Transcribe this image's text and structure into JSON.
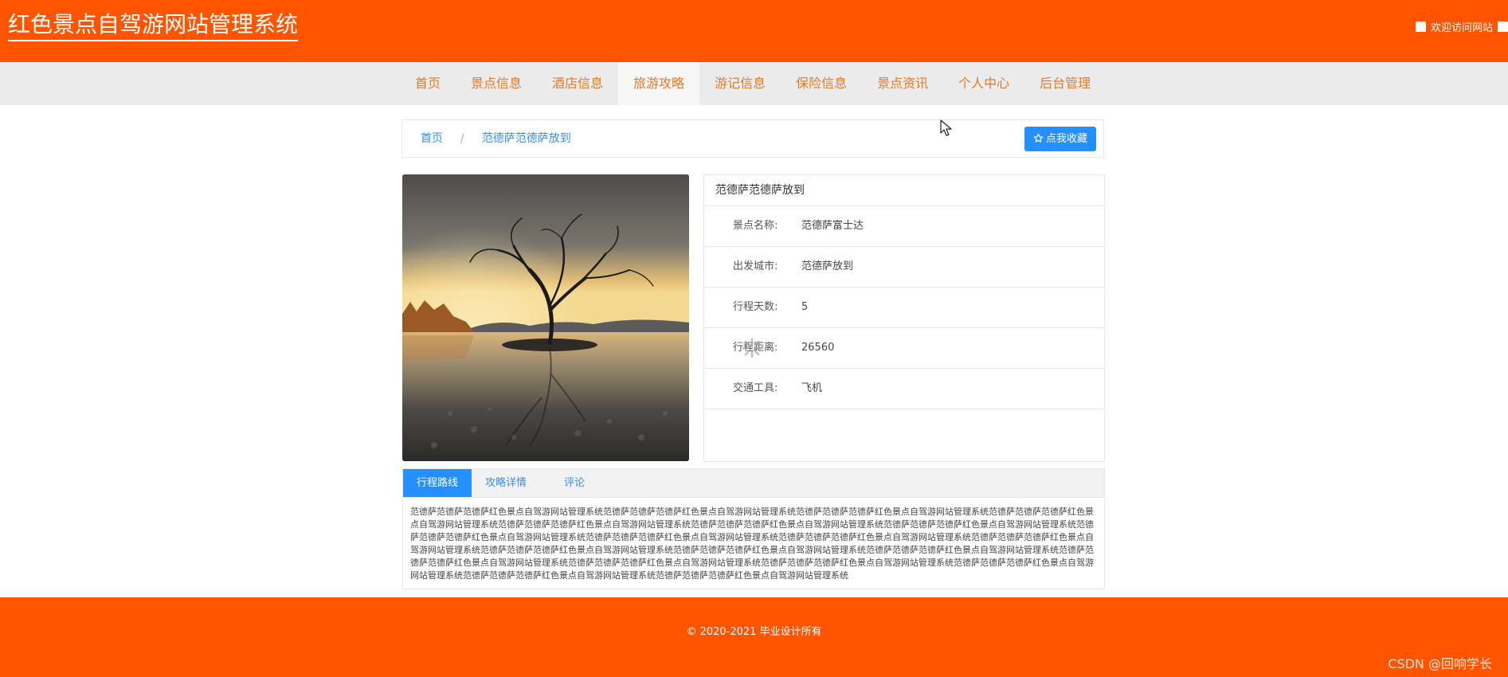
{
  "header": {
    "site_title": "红色景点自驾游网站管理系统",
    "welcome": "欢迎访问网站"
  },
  "nav": {
    "items": [
      {
        "label": "首页"
      },
      {
        "label": "景点信息"
      },
      {
        "label": "酒店信息"
      },
      {
        "label": "旅游攻略",
        "active": true
      },
      {
        "label": "游记信息"
      },
      {
        "label": "保险信息"
      },
      {
        "label": "景点资讯"
      },
      {
        "label": "个人中心"
      },
      {
        "label": "后台管理"
      }
    ]
  },
  "breadcrumb": {
    "home": "首页",
    "separator": "/",
    "current": "范德萨范德萨放到"
  },
  "actions": {
    "favorite_label": "点我收藏",
    "favorite_icon": "star-outline-icon"
  },
  "detail": {
    "title": "范德萨范德萨放到",
    "fields": [
      {
        "label": "景点名称:",
        "value": "范德萨富士达"
      },
      {
        "label": "出发城市:",
        "value": "范德萨放到"
      },
      {
        "label": "行程天数:",
        "value": "5"
      },
      {
        "label": "行程距离:",
        "value": "26560"
      },
      {
        "label": "交通工具:",
        "value": "飞机"
      }
    ]
  },
  "tabs": {
    "items": [
      {
        "label": "行程路线",
        "active": true
      },
      {
        "label": "攻略详情"
      },
      {
        "label": "评论"
      }
    ],
    "content": "范德萨范德萨范德萨红色景点自驾游网站管理系统范德萨范德萨范德萨红色景点自驾游网站管理系统范德萨范德萨范德萨红色景点自驾游网站管理系统范德萨范德萨范德萨红色景点自驾游网站管理系统范德萨范德萨范德萨红色景点自驾游网站管理系统范德萨范德萨范德萨红色景点自驾游网站管理系统范德萨范德萨范德萨红色景点自驾游网站管理系统范德萨范德萨范德萨红色景点自驾游网站管理系统范德萨范德萨范德萨红色景点自驾游网站管理系统范德萨范德萨范德萨红色景点自驾游网站管理系统范德萨范德萨范德萨红色景点自驾游网站管理系统范德萨范德萨范德萨红色景点自驾游网站管理系统范德萨范德萨范德萨红色景点自驾游网站管理系统范德萨范德萨范德萨红色景点自驾游网站管理系统范德萨范德萨范德萨红色景点自驾游网站管理系统范德萨范德萨范德萨红色景点自驾游网站管理系统范德萨范德萨范德萨红色景点自驾游网站管理系统范德萨范德萨范德萨红色景点自驾游网站管理系统范德萨范德萨范德萨红色景点自驾游网站管理系统范德萨范德萨范德萨红色景点自驾游网站管理系统"
  },
  "footer": {
    "copyright": "© 2020-2021 毕业设计所有",
    "watermark": "CSDN @回响学长"
  },
  "colors": {
    "brand": "#ff5400",
    "nav_text": "#e4782a",
    "accent_blue": "#2490ff",
    "link_blue": "#3a8ee6"
  }
}
